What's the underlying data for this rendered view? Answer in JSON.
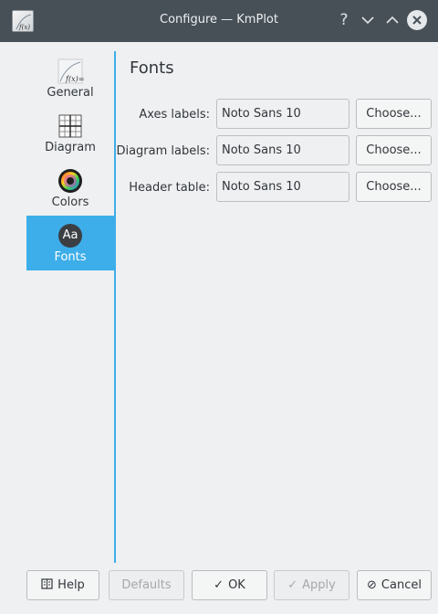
{
  "window": {
    "title": "Configure — KmPlot",
    "help_glyph": "?",
    "minimize_glyph": "∨",
    "maximize_glyph": "∧",
    "close_glyph": "✕"
  },
  "sidebar": {
    "items": [
      {
        "label": "General",
        "icon": "function-graph-icon",
        "active": false
      },
      {
        "label": "Diagram",
        "icon": "grid-icon",
        "active": false
      },
      {
        "label": "Colors",
        "icon": "color-wheel-icon",
        "active": false
      },
      {
        "label": "Fonts",
        "icon": "font-aa-icon",
        "active": true,
        "icon_text": "Aa"
      }
    ]
  },
  "main": {
    "title": "Fonts",
    "rows": [
      {
        "label": "Axes labels:",
        "value": "Noto Sans 10",
        "button": "Choose..."
      },
      {
        "label": "Diagram labels:",
        "value": "Noto Sans 10",
        "button": "Choose..."
      },
      {
        "label": "Header table:",
        "value": "Noto Sans 10",
        "button": "Choose..."
      }
    ]
  },
  "buttons": {
    "help": "Help",
    "defaults": "Defaults",
    "ok": "OK",
    "apply": "Apply",
    "cancel": "Cancel"
  },
  "colors": {
    "accent": "#3daee9",
    "titlebar": "#475057",
    "window_bg": "#eff0f1"
  }
}
